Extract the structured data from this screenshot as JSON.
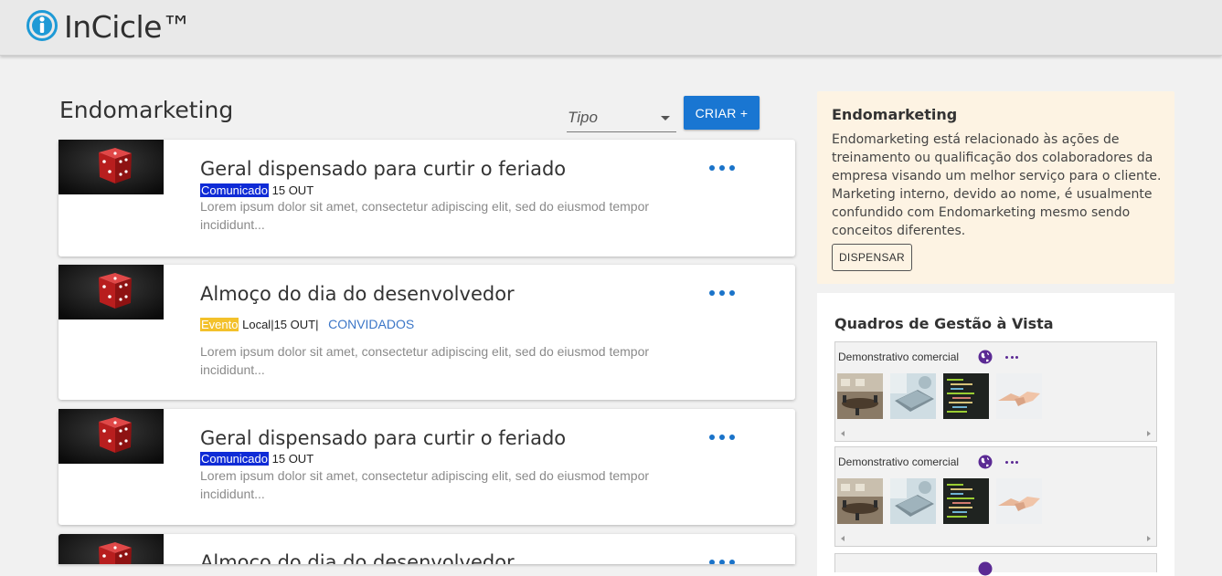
{
  "app": {
    "name": "InCicle™"
  },
  "main": {
    "title": "Endomarketing",
    "filter": {
      "placeholder": "Tipo"
    },
    "create_label": "CRIAR +",
    "posts": [
      {
        "title": "Geral dispensado para curtir o feriado",
        "badge": "Comunicado",
        "date": "15 OUT",
        "description": "Lorem ipsum dolor sit amet, consectetur adipiscing elit, sed do eiusmod tempor incididunt..."
      },
      {
        "title": "Almoço do dia do desenvolvedor",
        "badge": "Evento",
        "location_date": "Local|15 OUT|",
        "link": "CONVIDADOS",
        "description": "Lorem ipsum dolor sit amet, consectetur adipiscing elit, sed do eiusmod tempor incididunt..."
      },
      {
        "title": "Geral dispensado para curtir o feriado",
        "badge": "Comunicado",
        "date": "15 OUT",
        "description": "Lorem ipsum dolor sit amet, consectetur adipiscing elit, sed do eiusmod tempor incididunt..."
      },
      {
        "title": "Almoço do dia do desenvolvedor"
      }
    ]
  },
  "info": {
    "title": "Endomarketing",
    "text": "Endomarketing está relacionado às ações de treinamento ou qualificação dos colaboradores da empresa visando um melhor serviço para o cliente. Marketing interno, devido ao nome, é usualmente confundido com Endomarketing mesmo sendo conceitos diferentes.",
    "dismiss_label": "DISPENSAR"
  },
  "boards": {
    "title": "Quadros de Gestão à Vista",
    "items": [
      {
        "name": "Demonstrativo comercial"
      },
      {
        "name": "Demonstrativo comercial"
      }
    ]
  },
  "colors": {
    "primary": "#1976d2",
    "badge_comunicado": "#0f2bd6",
    "badge_evento": "#f3c12b",
    "info_background": "#fdf3e3",
    "globe": "#5b2a94"
  }
}
